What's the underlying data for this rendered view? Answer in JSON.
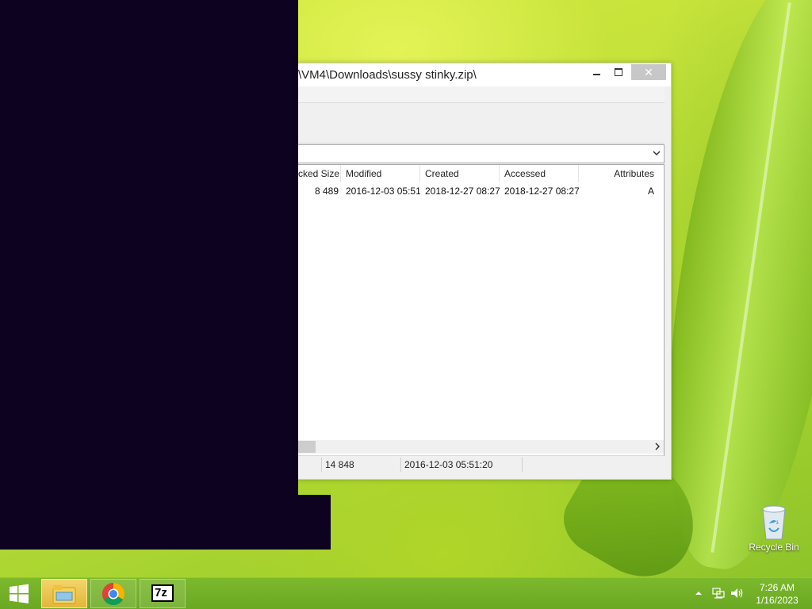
{
  "window": {
    "title": "\\VM4\\Downloads\\sussy stinky.zip\\",
    "controls": {
      "close": "✕"
    }
  },
  "list": {
    "columns": [
      "cked Size",
      "Modified",
      "Created",
      "Accessed",
      "Attributes"
    ],
    "rows": [
      {
        "packed_size": "8 489",
        "modified": "2016-12-03 05:51",
        "created": "2018-12-27 08:27",
        "accessed": "2018-12-27 08:27",
        "attributes": "A"
      }
    ]
  },
  "status": {
    "size": "14 848",
    "modified": "2016-12-03 05:51:20"
  },
  "desktop": {
    "recycle_bin_label": "Recycle Bin"
  },
  "taskbar": {
    "items": [
      "file-explorer",
      "google-chrome",
      "7-zip"
    ],
    "seven_zip_text": "7z",
    "time": "7:26 AM",
    "date": "1/16/2023"
  }
}
